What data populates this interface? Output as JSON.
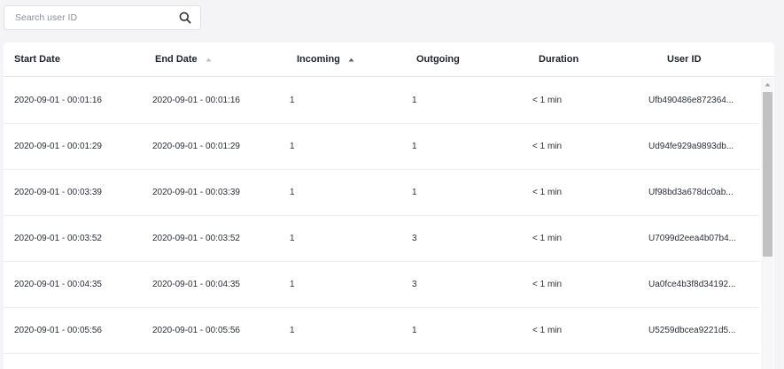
{
  "search": {
    "placeholder": "Search user ID",
    "value": "",
    "icon": "search-icon"
  },
  "table": {
    "columns": [
      {
        "key": "start",
        "label": "Start Date",
        "sort": "none"
      },
      {
        "key": "end",
        "label": "End Date",
        "sort": "inactive-asc"
      },
      {
        "key": "incoming",
        "label": "Incoming",
        "sort": "active-asc"
      },
      {
        "key": "outgoing",
        "label": "Outgoing",
        "sort": "none"
      },
      {
        "key": "duration",
        "label": "Duration",
        "sort": "none"
      },
      {
        "key": "user",
        "label": "User ID",
        "sort": "none"
      }
    ],
    "rows": [
      {
        "start": "2020-09-01 - 00:01:16",
        "end": "2020-09-01 - 00:01:16",
        "incoming": "1",
        "outgoing": "1",
        "duration": "< 1 min",
        "user": "Ufb490486e872364..."
      },
      {
        "start": "2020-09-01 - 00:01:29",
        "end": "2020-09-01 - 00:01:29",
        "incoming": "1",
        "outgoing": "1",
        "duration": "< 1 min",
        "user": "Ud94fe929a9893db..."
      },
      {
        "start": "2020-09-01 - 00:03:39",
        "end": "2020-09-01 - 00:03:39",
        "incoming": "1",
        "outgoing": "1",
        "duration": "< 1 min",
        "user": "Uf98bd3a678dc0ab..."
      },
      {
        "start": "2020-09-01 - 00:03:52",
        "end": "2020-09-01 - 00:03:52",
        "incoming": "1",
        "outgoing": "3",
        "duration": "< 1 min",
        "user": "U7099d2eea4b07b4..."
      },
      {
        "start": "2020-09-01 - 00:04:35",
        "end": "2020-09-01 - 00:04:35",
        "incoming": "1",
        "outgoing": "3",
        "duration": "< 1 min",
        "user": "Ua0fce4b3f8d34192..."
      },
      {
        "start": "2020-09-01 - 00:05:56",
        "end": "2020-09-01 - 00:05:56",
        "incoming": "1",
        "outgoing": "1",
        "duration": "< 1 min",
        "user": "U5259dbcea9221d5..."
      }
    ]
  },
  "colors": {
    "background": "#f4f4f6",
    "card": "#ffffff",
    "header_text": "#1f2329",
    "cell_text": "#2b2f36",
    "sort_active": "#5a5f66",
    "sort_inactive": "#b9bcc2",
    "scroll_thumb": "#c1c1c1"
  }
}
